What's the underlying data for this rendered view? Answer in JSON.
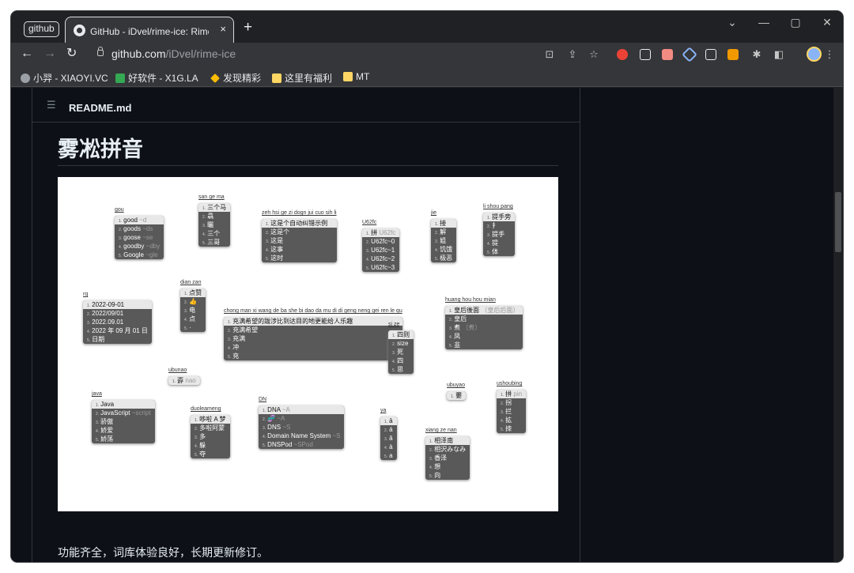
{
  "window": {
    "tab_group_label": "github",
    "tab_title": "GitHub - iDvel/rime-ice: Rime 配置",
    "tab_close": "×",
    "new_tab": "+",
    "controls": {
      "minimize": "—",
      "restore": "▢",
      "close": "✕",
      "tab_search": "⌄"
    }
  },
  "toolbar": {
    "back": "←",
    "forward": "→",
    "reload": "↻",
    "url_domain": "github.com",
    "url_path": "/iDvel/rime-ice",
    "install_icon": "⊡",
    "share_icon": "⇪",
    "bookmark_star": "☆",
    "menu_dots": "⋮",
    "extensions_icon": "✱",
    "sidepanel_icon": "◧"
  },
  "bookmarks": [
    {
      "label": "小羿 - XIAOYI.VC",
      "color": "#9aa0a6"
    },
    {
      "label": "好软件 - X1G.LA",
      "color": "#34a853"
    },
    {
      "label": "发现精彩",
      "color": "#fbbc04"
    },
    {
      "label": "这里有福利",
      "color": "#fdd663"
    },
    {
      "label": "MT",
      "color": "#fdd663"
    }
  ],
  "readme": {
    "header_icon": "☰",
    "filename": "README.md",
    "title": "雾凇拼音",
    "description": "功能齐全，词库体验良好，长期更新修订。"
  },
  "candidates": [
    {
      "code": "gou",
      "items": [
        "good",
        "goods",
        "goose",
        "goodby",
        "Google"
      ],
      "hints": [
        "~d",
        "~ds",
        "~se",
        "~dby",
        "~gle"
      ]
    },
    {
      "code": "san ge ma",
      "items": [
        "三个马",
        "骉",
        "矖",
        "三个",
        "三哥"
      ]
    },
    {
      "code": "zeh hsi ge zi dogn jui cuo sih li",
      "items": [
        "这是个自动纠错示例",
        "这是个",
        "这是",
        "这事",
        "这时"
      ]
    },
    {
      "code": "U62fc",
      "items": [
        "拼",
        "U62fc~0",
        "U62fc~1",
        "U62fc~2",
        "U62fc~3"
      ],
      "hints": [
        "U62fc",
        "",
        "",
        "",
        ""
      ]
    },
    {
      "code": "jie",
      "items": [
        "接",
        "解",
        "姐",
        "饥饿",
        "极恶"
      ]
    },
    {
      "code": "li shou pang",
      "items": [
        "提手旁",
        "扌",
        "提手",
        "提",
        "体"
      ]
    },
    {
      "code": "rq",
      "items": [
        "2022-09-01",
        "2022/09/01",
        "2022.09.01",
        "2022 年 09 月 01 日",
        "日期"
      ]
    },
    {
      "code": "dian zan",
      "items": [
        "点赞",
        "👍",
        "电",
        "点",
        "·"
      ]
    },
    {
      "code": "chong man xi wang de ba she bi dao da mu di di geng neng gei ren le qu",
      "items": [
        "充满希望的跋涉比到达目的地更能给人乐趣",
        "充满希望",
        "充满",
        "冲",
        "充"
      ]
    },
    {
      "code": "si ze",
      "items": [
        "四则",
        "size",
        "死",
        "四",
        "思"
      ]
    },
    {
      "code": "huang hou hou mian",
      "items": [
        "皇后後面",
        "皇后",
        "煮",
        "凤",
        "韭"
      ],
      "hints": [
        "（皇后后面）",
        "",
        "（煮）",
        "",
        ""
      ]
    },
    {
      "code": "ubunao",
      "items": [
        "孬"
      ],
      "hints": [
        "nao"
      ]
    },
    {
      "code": "java",
      "items": [
        "Java",
        "JavaScript",
        "骄傲",
        "娇爱",
        "娇荡"
      ],
      "hints": [
        "",
        "~script",
        "",
        "",
        ""
      ]
    },
    {
      "code": "duoleameng",
      "items": [
        "哆啦 A 梦",
        "多啦阿蒙",
        "多",
        "躲",
        "夺"
      ]
    },
    {
      "code": "DN",
      "items": [
        "DNA",
        "🧬",
        "DNS",
        "Domain Name System",
        "DNSPod"
      ],
      "hints": [
        "~A",
        "~A",
        "~S",
        "~S",
        "~SPod"
      ]
    },
    {
      "code": "ya",
      "items": [
        "ā",
        "á",
        "ǎ",
        "à",
        "a"
      ]
    },
    {
      "code": "ubuyao",
      "items": [
        "嫑"
      ]
    },
    {
      "code": "xiang ze nan",
      "items": [
        "相泽南",
        "相沢みなみ",
        "香泽",
        "想",
        "向"
      ]
    },
    {
      "code": "ushoubing",
      "items": [
        "拼",
        "拐",
        "拦",
        "拡",
        "拺"
      ],
      "hints": [
        "pin",
        "",
        "",
        "",
        ""
      ]
    }
  ]
}
